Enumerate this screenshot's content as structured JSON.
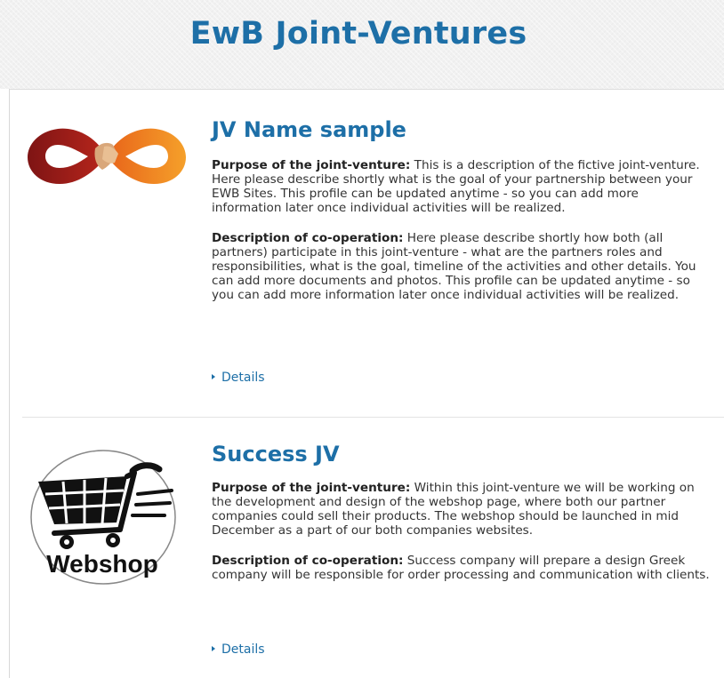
{
  "header": {
    "title": "EwB Joint-Ventures"
  },
  "jvs": [
    {
      "name": "JV Name sample",
      "logo_icon": "infinity-handshake-icon",
      "purpose_label": "Purpose of the joint-venture:",
      "purpose_text": " This is a description of the fictive joint-venture. Here please describe shortly what is the goal of your partnership between your EWB Sites. This profile can be updated anytime - so you can add more information later once individual activities will be realized.",
      "cooperation_label": "Description of co-operation:",
      "cooperation_text": " Here please describe shortly how both (all partners) participate in this joint-venture - what are the partners roles and responsibilities, what is the goal, timeline of the activities and other details. You can add more documents and photos. This profile can be updated anytime - so you can add more information later once individual activities will be realized.",
      "details_label": "Details"
    },
    {
      "name": "Success JV",
      "logo_icon": "webshop-cart-icon",
      "logo_text": "Webshop",
      "purpose_label": "Purpose of the joint-venture:",
      "purpose_text": " Within this joint-venture we will be working on the development and design of the webshop page, where both our partner companies could sell their products. The webshop should be launched in mid December as a part of our both companies websites.",
      "cooperation_label": "Description of co-operation:",
      "cooperation_text": " Success company will prepare a design Greek company will be responsible for order processing and communication with clients.",
      "details_label": "Details"
    }
  ],
  "colors": {
    "accent": "#1d6fa7",
    "text": "#333333",
    "infinity_left": "#9c1c1c",
    "infinity_right": "#f08a1c"
  }
}
